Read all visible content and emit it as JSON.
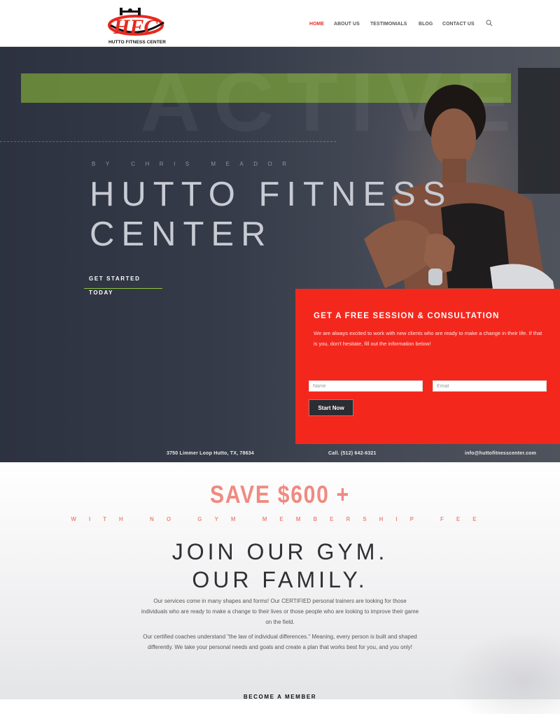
{
  "header": {
    "logo_text": "HFC",
    "logo_subtitle": "HUTTO FITNESS CENTER",
    "nav": [
      {
        "label": "HOME",
        "active": true
      },
      {
        "label": "ABOUT US",
        "active": false
      },
      {
        "label": "TESTIMONIALS",
        "active": false
      },
      {
        "label": "BLOG",
        "active": false
      },
      {
        "label": "CONTACT US",
        "active": false
      }
    ]
  },
  "hero": {
    "byline": "BY CHRIS MEADOR",
    "title_line1": "HUTTO FITNESS",
    "title_line2": "CENTER",
    "cta": "GET STARTED TODAY",
    "watermark": "ACTIVE"
  },
  "form": {
    "title": "GET A FREE SESSION & CONSULTATION",
    "text": "We are always excited to work with new clients who are ready to make a change in their life. If that is you, don't hesitate, fill out the information below!",
    "name_placeholder": "Name",
    "email_placeholder": "Email",
    "submit": "Start Now"
  },
  "contact": {
    "address": "3750 Limmer Loop Hutto, TX, 78634",
    "phone": "Call. (512) 642-6321",
    "email": "info@huttofitnesscenter.com"
  },
  "promo": {
    "headline": "SAVE $600 +",
    "subline": "WITH NO GYM MEMBERSHIP FEE",
    "title_line1": "JOIN OUR GYM.",
    "title_line2": "OUR FAMILY.",
    "para1": "Our services come in many shapes and forms! Our CERTIFIED personal trainers are looking for those individuals who are ready to make a change to their lives or those people who are looking to improve their game on the field.",
    "para2": "Our certified coaches understand \"the law of individual differences.\" Meaning, every person is built and shaped differently. We take your personal needs and goals and create a plan that works best for you, and you only!",
    "cta": "BECOME A MEMBER"
  },
  "colors": {
    "accent_red": "#f4271d",
    "nav_active": "#e8291f",
    "cta_underline": "#8cc63f",
    "promo_pink": "#f08a80"
  },
  "icons": {
    "search": "search-icon"
  }
}
